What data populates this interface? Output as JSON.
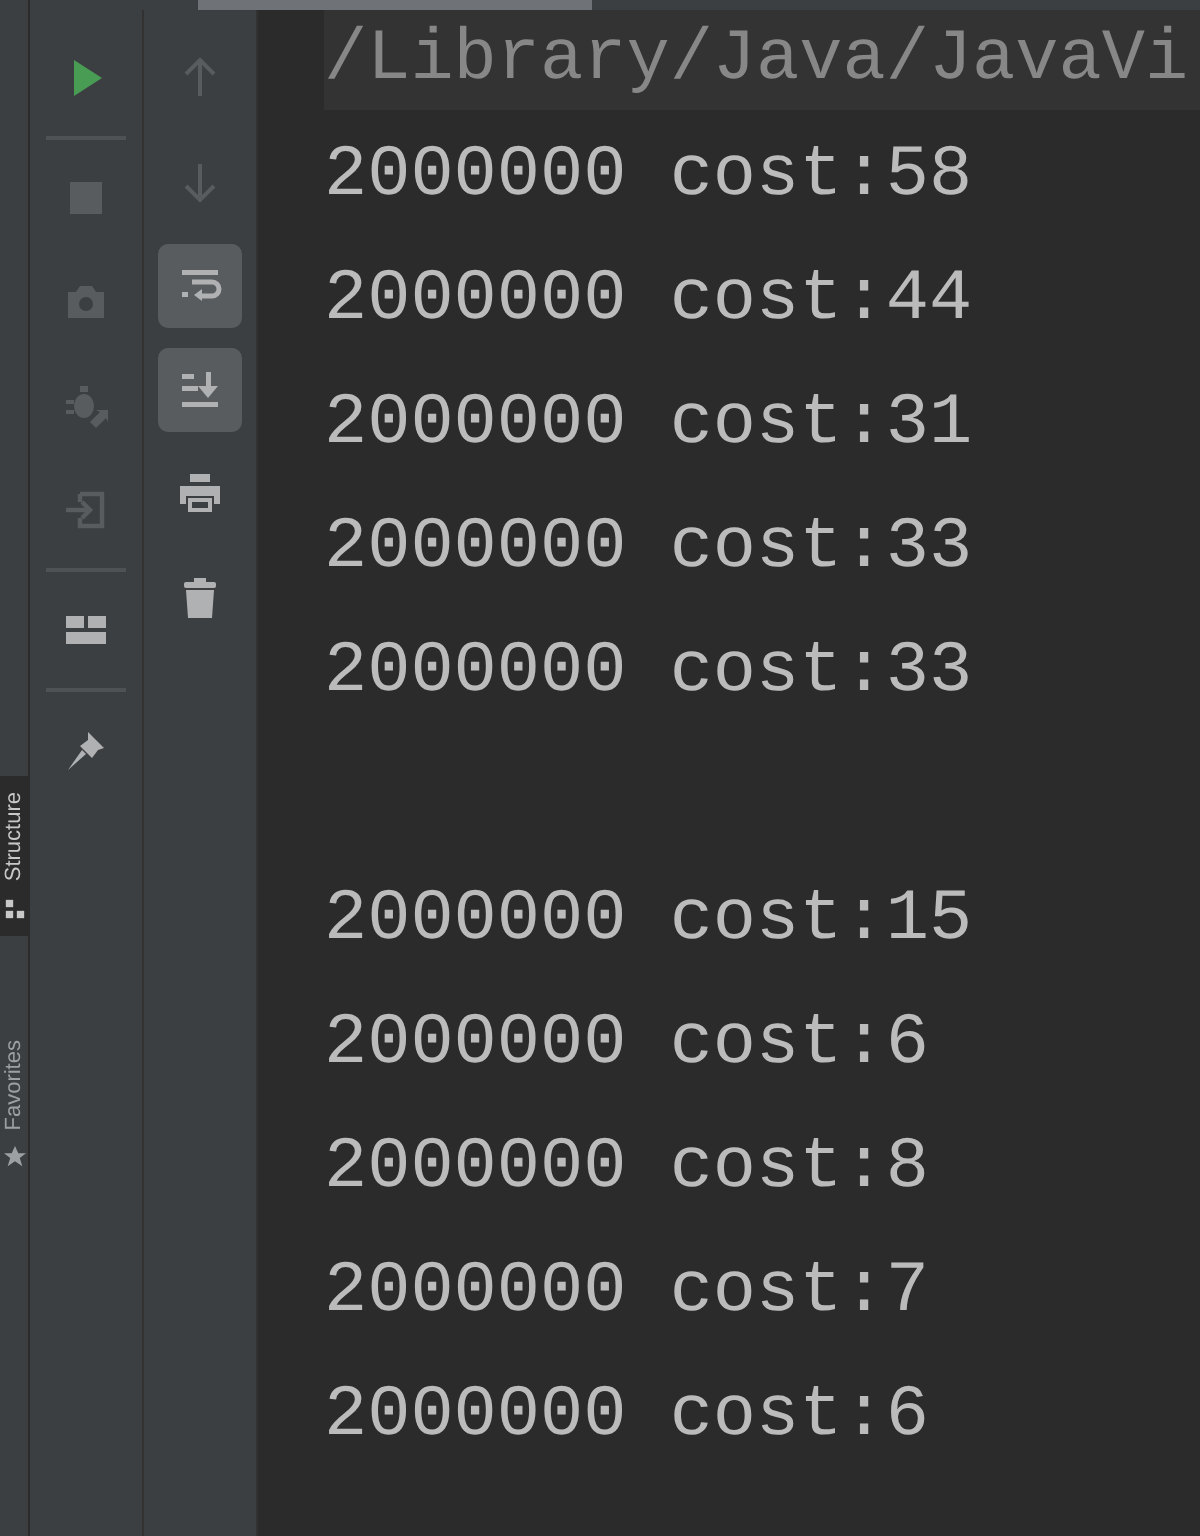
{
  "side_tabs": [
    {
      "label": "Structure",
      "selected": true
    },
    {
      "label": "Favorites",
      "selected": false
    }
  ],
  "run_toolbar": [
    {
      "kind": "run",
      "disabled": false
    },
    {
      "kind": "separator"
    },
    {
      "kind": "stop",
      "disabled": true
    },
    {
      "kind": "camera",
      "disabled": true
    },
    {
      "kind": "debug",
      "disabled": true
    },
    {
      "kind": "exit",
      "disabled": true
    },
    {
      "kind": "separator"
    },
    {
      "kind": "layout",
      "disabled": false
    },
    {
      "kind": "separator"
    },
    {
      "kind": "pin",
      "disabled": false
    }
  ],
  "console_toolbar": [
    {
      "kind": "up",
      "disabled": true,
      "on": false
    },
    {
      "kind": "down",
      "disabled": true,
      "on": false
    },
    {
      "kind": "soft-wrap",
      "disabled": false,
      "on": true
    },
    {
      "kind": "scroll-to-end",
      "disabled": false,
      "on": true
    },
    {
      "kind": "print",
      "disabled": false,
      "on": false
    },
    {
      "kind": "clear",
      "disabled": false,
      "on": false
    }
  ],
  "console_lines": [
    {
      "kind": "command",
      "text": "/Library/Java/JavaVi"
    },
    {
      "kind": "output",
      "text": "2000000 cost:58"
    },
    {
      "kind": "output",
      "text": "2000000 cost:44"
    },
    {
      "kind": "output",
      "text": "2000000 cost:31"
    },
    {
      "kind": "output",
      "text": "2000000 cost:33"
    },
    {
      "kind": "output",
      "text": "2000000 cost:33"
    },
    {
      "kind": "blank"
    },
    {
      "kind": "output",
      "text": "2000000 cost:15"
    },
    {
      "kind": "output",
      "text": "2000000 cost:6"
    },
    {
      "kind": "output",
      "text": "2000000 cost:8"
    },
    {
      "kind": "output",
      "text": "2000000 cost:7"
    },
    {
      "kind": "output",
      "text": "2000000 cost:6"
    }
  ]
}
